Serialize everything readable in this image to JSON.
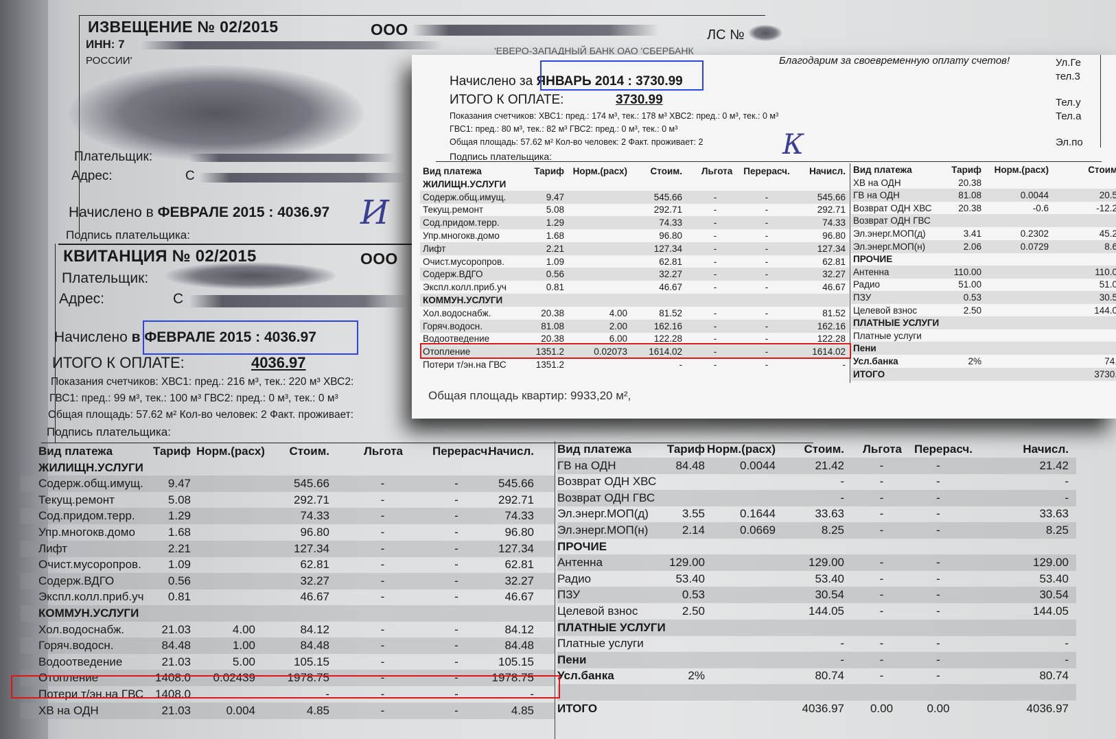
{
  "header": {
    "notice_title": "ИЗВЕЩЕНИЕ № 02/2015",
    "org_prefix": "ООО",
    "inn_label": "ИНН: 7",
    "bank_word": "РОССИИ'",
    "bank_name": "'ЕВЕРО-ЗАПАДНЫЙ БАНК ОАО 'СБЕРБАНК",
    "ls_label": "ЛС №"
  },
  "notice": {
    "payer_label": "Плательщик:",
    "address_label": "Адрес:",
    "address_start": "С",
    "charged_prefix": "Начислено в ",
    "charged_period": "ФЕВРАЛЕ 2015 : 4036.97",
    "signature_label": "Подпись плательщика:",
    "signature_mark": "И"
  },
  "receipt": {
    "title": "КВИТАНЦИЯ № 02/2015",
    "org_prefix": "ООО",
    "payer_label": "Плательщик:",
    "address_label": "Адрес:",
    "address_start": "С",
    "charged_prefix": "Начислено ",
    "charged_period": "в ФЕВРАЛЕ 2015 : 4036.97",
    "total_label": "ИТОГО К ОПЛАТЕ:",
    "total_value": "4036.97",
    "meters_line1": "Показания счетчиков: ХВС1: пред.: 216 м³, тек.: 220 м³   ХВС2:",
    "meters_line2": "ГВС1: пред.: 99 м³, тек.: 100 м³   ГВС2: пред.: 0 м³, тек.: 0 м³",
    "area_line": "Общая площадь: 57.62 м²  Кол-во человек: 2  Факт. проживает:",
    "signature_label": "Подпись плательщика:"
  },
  "columns": [
    "Вид платежа",
    "Тариф",
    "Норм.(расх)",
    "Стоим.",
    "Льгота",
    "Перерасч.",
    "Начисл."
  ],
  "feb_left": [
    {
      "s": "ЖИЛИЩН.УСЛУГИ"
    },
    {
      "n": "Содерж.общ.имущ.",
      "t": "9.47",
      "norm": "",
      "st": "545.66",
      "l": "-",
      "p": "-",
      "a": "545.66"
    },
    {
      "n": "Текущ.ремонт",
      "t": "5.08",
      "norm": "",
      "st": "292.71",
      "l": "-",
      "p": "-",
      "a": "292.71"
    },
    {
      "n": "Сод.придом.терр.",
      "t": "1.29",
      "norm": "",
      "st": "74.33",
      "l": "-",
      "p": "-",
      "a": "74.33"
    },
    {
      "n": "Упр.многокв.домо",
      "t": "1.68",
      "norm": "",
      "st": "96.80",
      "l": "-",
      "p": "-",
      "a": "96.80"
    },
    {
      "n": "Лифт",
      "t": "2.21",
      "norm": "",
      "st": "127.34",
      "l": "-",
      "p": "-",
      "a": "127.34"
    },
    {
      "n": "Очист.мусоропров.",
      "t": "1.09",
      "norm": "",
      "st": "62.81",
      "l": "-",
      "p": "-",
      "a": "62.81"
    },
    {
      "n": "Содерж.ВДГО",
      "t": "0.56",
      "norm": "",
      "st": "32.27",
      "l": "-",
      "p": "-",
      "a": "32.27"
    },
    {
      "n": "Экспл.колл.приб.уч",
      "t": "0.81",
      "norm": "",
      "st": "46.67",
      "l": "-",
      "p": "-",
      "a": "46.67"
    },
    {
      "s": "КОММУН.УСЛУГИ"
    },
    {
      "n": "Хол.водоснабж.",
      "t": "21.03",
      "norm": "4.00",
      "st": "84.12",
      "l": "-",
      "p": "-",
      "a": "84.12"
    },
    {
      "n": "Горяч.водосн.",
      "t": "84.48",
      "norm": "1.00",
      "st": "84.48",
      "l": "-",
      "p": "-",
      "a": "84.48"
    },
    {
      "n": "Водоотведение",
      "t": "21.03",
      "norm": "5.00",
      "st": "105.15",
      "l": "-",
      "p": "-",
      "a": "105.15"
    },
    {
      "n": "Отопление",
      "t": "1408.0",
      "norm": "0.02439",
      "st": "1978.75",
      "l": "-",
      "p": "-",
      "a": "1978.75"
    },
    {
      "n": "Потери т/эн.на ГВС",
      "t": "1408.0",
      "norm": "",
      "st": "-",
      "l": "-",
      "p": "-",
      "a": "-"
    },
    {
      "n": "ХВ на ОДН",
      "t": "21.03",
      "norm": "0.004",
      "st": "4.85",
      "l": "-",
      "p": "-",
      "a": "4.85"
    }
  ],
  "feb_right": [
    {
      "n": "ГВ на ОДН",
      "t": "84.48",
      "norm": "0.0044",
      "st": "21.42",
      "l": "-",
      "p": "-",
      "a": "21.42"
    },
    {
      "n": "Возврат ОДН ХВС",
      "t": "",
      "norm": "",
      "st": "-",
      "l": "-",
      "p": "-",
      "a": "-"
    },
    {
      "n": "Возврат ОДН ГВС",
      "t": "",
      "norm": "",
      "st": "-",
      "l": "-",
      "p": "-",
      "a": "-"
    },
    {
      "n": "Эл.энерг.МОП(д)",
      "t": "3.55",
      "norm": "0.1644",
      "st": "33.63",
      "l": "-",
      "p": "-",
      "a": "33.63"
    },
    {
      "n": "Эл.энерг.МОП(н)",
      "t": "2.14",
      "norm": "0.0669",
      "st": "8.25",
      "l": "-",
      "p": "-",
      "a": "8.25"
    },
    {
      "s": "ПРОЧИЕ"
    },
    {
      "n": "Антенна",
      "t": "129.00",
      "norm": "",
      "st": "129.00",
      "l": "-",
      "p": "-",
      "a": "129.00"
    },
    {
      "n": "Радио",
      "t": "53.40",
      "norm": "",
      "st": "53.40",
      "l": "-",
      "p": "-",
      "a": "53.40"
    },
    {
      "n": "ПЗУ",
      "t": "0.53",
      "norm": "",
      "st": "30.54",
      "l": "-",
      "p": "-",
      "a": "30.54"
    },
    {
      "n": "Целевой взнос",
      "t": "2.50",
      "norm": "",
      "st": "144.05",
      "l": "-",
      "p": "-",
      "a": "144.05"
    },
    {
      "s": "ПЛАТНЫЕ УСЛУГИ"
    },
    {
      "n": "Платные услуги",
      "t": "",
      "norm": "",
      "st": "-",
      "l": "-",
      "p": "-",
      "a": "-"
    },
    {
      "sb": "Пени",
      "t": "",
      "norm": "",
      "st": "-",
      "l": "-",
      "p": "-",
      "a": "-"
    },
    {
      "sb": "Усл.банка",
      "t": "2%",
      "norm": "",
      "st": "80.74",
      "l": "-",
      "p": "-",
      "a": "80.74"
    },
    {
      "blank": true
    },
    {
      "sb": "ИТОГО",
      "t": "",
      "norm": "",
      "st": "4036.97",
      "l": "0.00",
      "p": "0.00",
      "a": "4036.97"
    }
  ],
  "jan": {
    "thanks": "Благодарим за своевременную оплату счетов!",
    "charged_prefix": "Начислено за ",
    "charged_period": "ЯНВАРЬ 2014 : 3730.99",
    "total_label": "ИТОГО К ОПЛАТЕ:",
    "total_value": "3730.99",
    "meters_line1": "Показания счетчиков: ХВС1: пред.: 174 м³, тек.: 178 м³    ХВС2: пред.: 0 м³, тек.: 0 м³",
    "meters_line2": "ГВС1: пред.: 80 м³, тек.: 82 м³     ГВС2: пред.: 0 м³, тек.: 0 м³",
    "area_line": "Общая площадь: 57.62 м²  Кол-во человек: 2  Факт. проживает: 2",
    "signature_label": "Подпись плательщика:",
    "signature_mark": "К",
    "side_text": [
      "Ул.Ге",
      "тел.3",
      "Тел.у",
      "Тел.а",
      "Эл.по"
    ],
    "footer": "Общая площадь квартир: 9933,20 м²,",
    "right_columns": [
      "Вид платежа",
      "Тариф",
      "Норм.(расх)",
      "Стоим"
    ],
    "left": [
      {
        "s": "ЖИЛИЩН.УСЛУГИ"
      },
      {
        "n": "Содерж.общ.имущ.",
        "t": "9.47",
        "norm": "",
        "st": "545.66",
        "l": "-",
        "p": "-",
        "a": "545.66"
      },
      {
        "n": "Текущ.ремонт",
        "t": "5.08",
        "norm": "",
        "st": "292.71",
        "l": "-",
        "p": "-",
        "a": "292.71"
      },
      {
        "n": "Сод.придом.терр.",
        "t": "1.29",
        "norm": "",
        "st": "74.33",
        "l": "-",
        "p": "-",
        "a": "74.33"
      },
      {
        "n": "Упр.многокв.домо",
        "t": "1.68",
        "norm": "",
        "st": "96.80",
        "l": "-",
        "p": "-",
        "a": "96.80"
      },
      {
        "n": "Лифт",
        "t": "2.21",
        "norm": "",
        "st": "127.34",
        "l": "-",
        "p": "-",
        "a": "127.34"
      },
      {
        "n": "Очист.мусоропров.",
        "t": "1.09",
        "norm": "",
        "st": "62.81",
        "l": "-",
        "p": "-",
        "a": "62.81"
      },
      {
        "n": "Содерж.ВДГО",
        "t": "0.56",
        "norm": "",
        "st": "32.27",
        "l": "-",
        "p": "-",
        "a": "32.27"
      },
      {
        "n": "Экспл.колл.приб.уч",
        "t": "0.81",
        "norm": "",
        "st": "46.67",
        "l": "-",
        "p": "-",
        "a": "46.67"
      },
      {
        "s": "КОММУН.УСЛУГИ"
      },
      {
        "n": "Хол.водоснабж.",
        "t": "20.38",
        "norm": "4.00",
        "st": "81.52",
        "l": "-",
        "p": "-",
        "a": "81.52"
      },
      {
        "n": "Горяч.водосн.",
        "t": "81.08",
        "norm": "2.00",
        "st": "162.16",
        "l": "-",
        "p": "-",
        "a": "162.16"
      },
      {
        "n": "Водоотведение",
        "t": "20.38",
        "norm": "6.00",
        "st": "122.28",
        "l": "-",
        "p": "-",
        "a": "122.28"
      },
      {
        "n": "Отопление",
        "t": "1351.2",
        "norm": "0.02073",
        "st": "1614.02",
        "l": "-",
        "p": "-",
        "a": "1614.02"
      },
      {
        "n": "Потери т/эн.на ГВС",
        "t": "1351.2",
        "norm": "",
        "st": "-",
        "l": "-",
        "p": "-",
        "a": "-"
      }
    ],
    "right": [
      {
        "n": "ХВ на ОДН",
        "t": "20.38",
        "norm": "",
        "st": ""
      },
      {
        "n": "ГВ на ОДН",
        "t": "81.08",
        "norm": "0.0044",
        "st": "20.5"
      },
      {
        "n": "Возврат ОДН ХВС",
        "t": "20.38",
        "norm": "-0.6",
        "st": "-12.2"
      },
      {
        "n": "Возврат ОДН ГВС",
        "t": "",
        "norm": "",
        "st": ""
      },
      {
        "n": "Эл.энерг.МОП(д)",
        "t": "3.41",
        "norm": "0.2302",
        "st": "45.2"
      },
      {
        "n": "Эл.энерг.МОП(н)",
        "t": "2.06",
        "norm": "0.0729",
        "st": "8.6"
      },
      {
        "s": "ПРОЧИЕ"
      },
      {
        "n": "Антенна",
        "t": "110.00",
        "norm": "",
        "st": "110.0"
      },
      {
        "n": "Радио",
        "t": "51.00",
        "norm": "",
        "st": "51.0"
      },
      {
        "n": "ПЗУ",
        "t": "0.53",
        "norm": "",
        "st": "30.5"
      },
      {
        "n": "Целевой взнос",
        "t": "2.50",
        "norm": "",
        "st": "144.0"
      },
      {
        "s": "ПЛАТНЫЕ УСЛУГИ"
      },
      {
        "n": "Платные услуги",
        "t": "",
        "norm": "",
        "st": ""
      },
      {
        "sb": "Пени",
        "t": "",
        "norm": "",
        "st": ""
      },
      {
        "sb": "Усл.банка",
        "t": "2%",
        "norm": "",
        "st": "74."
      },
      {
        "sb": "ИТОГО",
        "t": "",
        "norm": "",
        "st": "3730."
      }
    ]
  }
}
